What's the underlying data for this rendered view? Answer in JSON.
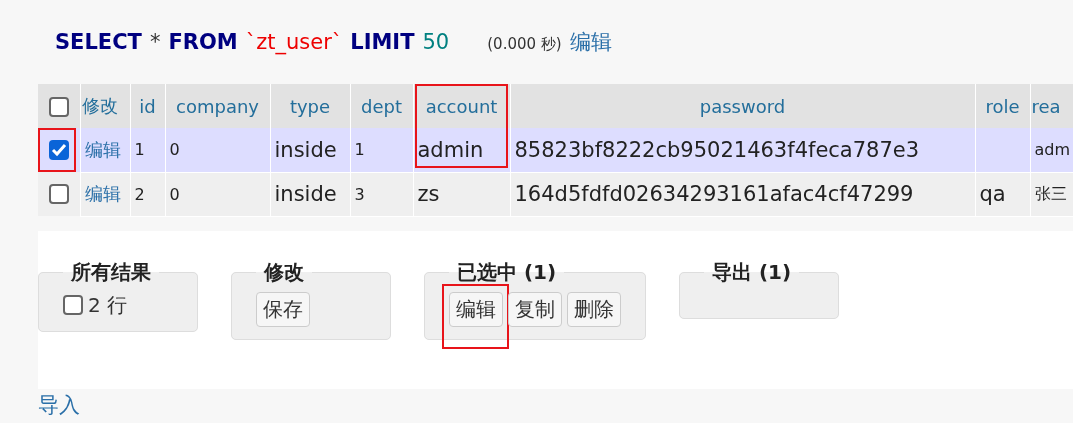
{
  "query": {
    "select": "SELECT",
    "star": "*",
    "from": "FROM",
    "table": "`zt_user`",
    "limit": "LIMIT",
    "count": "50",
    "time": "(0.000 秒)",
    "edit_link": "编辑"
  },
  "table": {
    "edit_header": "修改",
    "header_checkbox": {
      "checked": false
    },
    "columns": [
      {
        "label": "id",
        "highlighted": false
      },
      {
        "label": "company",
        "highlighted": false
      },
      {
        "label": "type",
        "highlighted": false
      },
      {
        "label": "dept",
        "highlighted": false
      },
      {
        "label": "account",
        "highlighted": true
      },
      {
        "label": "password",
        "highlighted": false
      },
      {
        "label": "role",
        "highlighted": false
      },
      {
        "label": "rea",
        "highlighted": false
      }
    ],
    "rows": [
      {
        "checked": true,
        "selected": true,
        "highlighted": true,
        "edit": "编辑",
        "cells": [
          "1",
          "0",
          "inside",
          "1",
          "admin",
          "85823bf8222cb95021463f4feca787e3",
          "",
          "adm"
        ]
      },
      {
        "checked": false,
        "selected": false,
        "highlighted": false,
        "edit": "编辑",
        "cells": [
          "2",
          "0",
          "inside",
          "3",
          "zs",
          "164d5fdfd02634293161afac4cf47299",
          "qa",
          "张三"
        ]
      }
    ]
  },
  "groups": [
    {
      "legend": "所有结果",
      "checkbox": {
        "checked": false,
        "label": "2 行"
      }
    },
    {
      "legend": "修改",
      "buttons": [
        {
          "label": "保存",
          "highlighted": false
        }
      ]
    },
    {
      "legend": "已选中 (1)",
      "buttons": [
        {
          "label": "编辑",
          "highlighted": true
        },
        {
          "label": "复制",
          "highlighted": false
        },
        {
          "label": "删除",
          "highlighted": false
        }
      ]
    },
    {
      "legend": "导出 (1)"
    }
  ],
  "import_link": "导入"
}
